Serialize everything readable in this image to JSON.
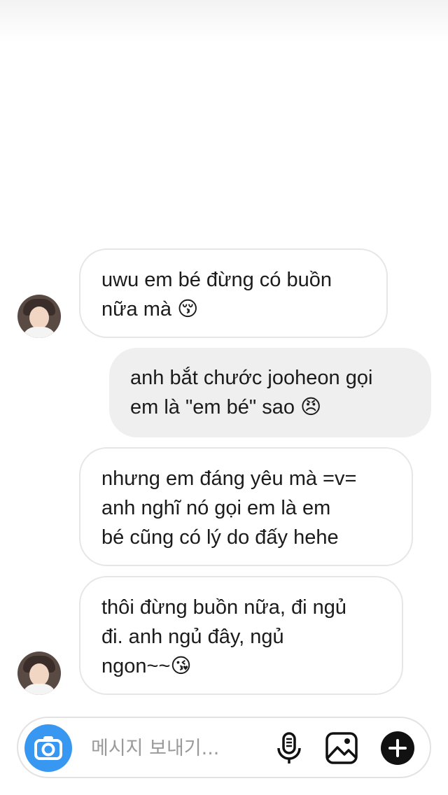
{
  "conversation": {
    "messages": [
      {
        "direction": "incoming",
        "text": "uwu em bé đừng có buồn\nnữa mà 😚"
      },
      {
        "direction": "outgoing",
        "text": "anh bắt chước jooheon gọi\nem là \"em bé\" sao 😠"
      },
      {
        "direction": "incoming",
        "text": "nhưng em đáng yêu mà =v=\nanh nghĩ nó gọi em là em\nbé cũng có lý do đấy hehe"
      },
      {
        "direction": "incoming",
        "text": "thôi đừng buồn nữa, đi ngủ\nđi. anh ngủ đây, ngủ\nngon~~😘"
      }
    ]
  },
  "composer": {
    "placeholder": "메시지 보내기...",
    "camera_icon": "camera-icon",
    "mic_icon": "microphone-icon",
    "gallery_icon": "image-gallery-icon",
    "more_icon": "plus-icon"
  },
  "colors": {
    "accent": "#3897f0",
    "incoming_border": "#e6e6e6",
    "outgoing_bg": "#efefef"
  }
}
